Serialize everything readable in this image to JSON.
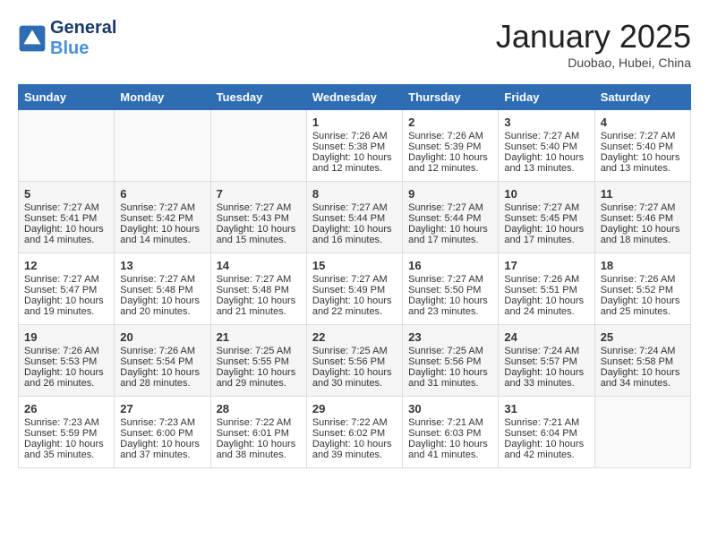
{
  "header": {
    "logo_line1": "General",
    "logo_line2": "Blue",
    "month": "January 2025",
    "location": "Duobao, Hubei, China"
  },
  "days_of_week": [
    "Sunday",
    "Monday",
    "Tuesday",
    "Wednesday",
    "Thursday",
    "Friday",
    "Saturday"
  ],
  "weeks": [
    [
      {
        "day": "",
        "content": ""
      },
      {
        "day": "",
        "content": ""
      },
      {
        "day": "",
        "content": ""
      },
      {
        "day": "1",
        "content": "Sunrise: 7:26 AM\nSunset: 5:38 PM\nDaylight: 10 hours\nand 12 minutes."
      },
      {
        "day": "2",
        "content": "Sunrise: 7:26 AM\nSunset: 5:39 PM\nDaylight: 10 hours\nand 12 minutes."
      },
      {
        "day": "3",
        "content": "Sunrise: 7:27 AM\nSunset: 5:40 PM\nDaylight: 10 hours\nand 13 minutes."
      },
      {
        "day": "4",
        "content": "Sunrise: 7:27 AM\nSunset: 5:40 PM\nDaylight: 10 hours\nand 13 minutes."
      }
    ],
    [
      {
        "day": "5",
        "content": "Sunrise: 7:27 AM\nSunset: 5:41 PM\nDaylight: 10 hours\nand 14 minutes."
      },
      {
        "day": "6",
        "content": "Sunrise: 7:27 AM\nSunset: 5:42 PM\nDaylight: 10 hours\nand 14 minutes."
      },
      {
        "day": "7",
        "content": "Sunrise: 7:27 AM\nSunset: 5:43 PM\nDaylight: 10 hours\nand 15 minutes."
      },
      {
        "day": "8",
        "content": "Sunrise: 7:27 AM\nSunset: 5:44 PM\nDaylight: 10 hours\nand 16 minutes."
      },
      {
        "day": "9",
        "content": "Sunrise: 7:27 AM\nSunset: 5:44 PM\nDaylight: 10 hours\nand 17 minutes."
      },
      {
        "day": "10",
        "content": "Sunrise: 7:27 AM\nSunset: 5:45 PM\nDaylight: 10 hours\nand 17 minutes."
      },
      {
        "day": "11",
        "content": "Sunrise: 7:27 AM\nSunset: 5:46 PM\nDaylight: 10 hours\nand 18 minutes."
      }
    ],
    [
      {
        "day": "12",
        "content": "Sunrise: 7:27 AM\nSunset: 5:47 PM\nDaylight: 10 hours\nand 19 minutes."
      },
      {
        "day": "13",
        "content": "Sunrise: 7:27 AM\nSunset: 5:48 PM\nDaylight: 10 hours\nand 20 minutes."
      },
      {
        "day": "14",
        "content": "Sunrise: 7:27 AM\nSunset: 5:48 PM\nDaylight: 10 hours\nand 21 minutes."
      },
      {
        "day": "15",
        "content": "Sunrise: 7:27 AM\nSunset: 5:49 PM\nDaylight: 10 hours\nand 22 minutes."
      },
      {
        "day": "16",
        "content": "Sunrise: 7:27 AM\nSunset: 5:50 PM\nDaylight: 10 hours\nand 23 minutes."
      },
      {
        "day": "17",
        "content": "Sunrise: 7:26 AM\nSunset: 5:51 PM\nDaylight: 10 hours\nand 24 minutes."
      },
      {
        "day": "18",
        "content": "Sunrise: 7:26 AM\nSunset: 5:52 PM\nDaylight: 10 hours\nand 25 minutes."
      }
    ],
    [
      {
        "day": "19",
        "content": "Sunrise: 7:26 AM\nSunset: 5:53 PM\nDaylight: 10 hours\nand 26 minutes."
      },
      {
        "day": "20",
        "content": "Sunrise: 7:26 AM\nSunset: 5:54 PM\nDaylight: 10 hours\nand 28 minutes."
      },
      {
        "day": "21",
        "content": "Sunrise: 7:25 AM\nSunset: 5:55 PM\nDaylight: 10 hours\nand 29 minutes."
      },
      {
        "day": "22",
        "content": "Sunrise: 7:25 AM\nSunset: 5:56 PM\nDaylight: 10 hours\nand 30 minutes."
      },
      {
        "day": "23",
        "content": "Sunrise: 7:25 AM\nSunset: 5:56 PM\nDaylight: 10 hours\nand 31 minutes."
      },
      {
        "day": "24",
        "content": "Sunrise: 7:24 AM\nSunset: 5:57 PM\nDaylight: 10 hours\nand 33 minutes."
      },
      {
        "day": "25",
        "content": "Sunrise: 7:24 AM\nSunset: 5:58 PM\nDaylight: 10 hours\nand 34 minutes."
      }
    ],
    [
      {
        "day": "26",
        "content": "Sunrise: 7:23 AM\nSunset: 5:59 PM\nDaylight: 10 hours\nand 35 minutes."
      },
      {
        "day": "27",
        "content": "Sunrise: 7:23 AM\nSunset: 6:00 PM\nDaylight: 10 hours\nand 37 minutes."
      },
      {
        "day": "28",
        "content": "Sunrise: 7:22 AM\nSunset: 6:01 PM\nDaylight: 10 hours\nand 38 minutes."
      },
      {
        "day": "29",
        "content": "Sunrise: 7:22 AM\nSunset: 6:02 PM\nDaylight: 10 hours\nand 39 minutes."
      },
      {
        "day": "30",
        "content": "Sunrise: 7:21 AM\nSunset: 6:03 PM\nDaylight: 10 hours\nand 41 minutes."
      },
      {
        "day": "31",
        "content": "Sunrise: 7:21 AM\nSunset: 6:04 PM\nDaylight: 10 hours\nand 42 minutes."
      },
      {
        "day": "",
        "content": ""
      }
    ]
  ]
}
